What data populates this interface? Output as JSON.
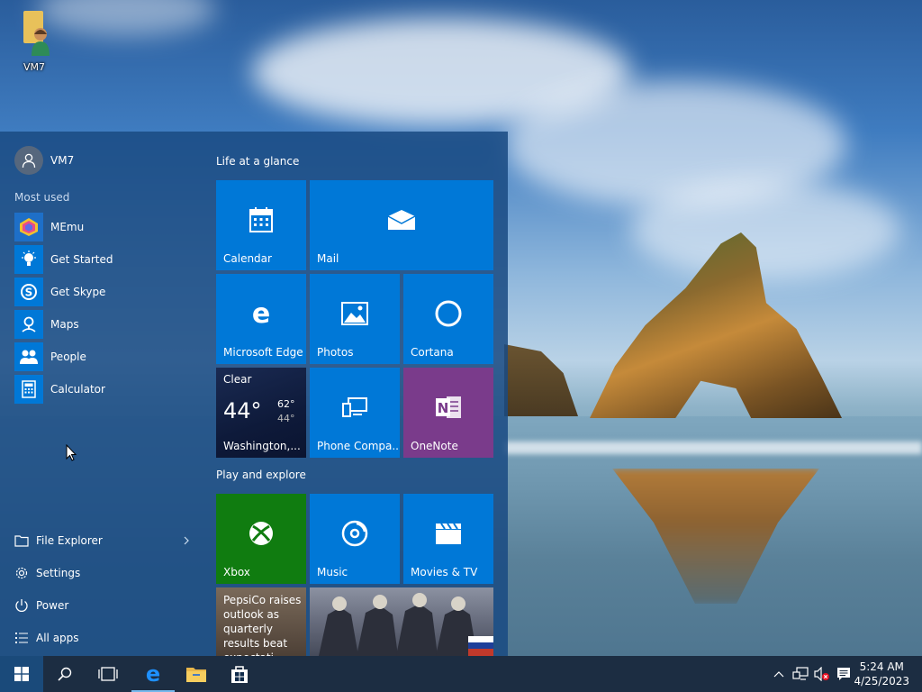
{
  "desktop": {
    "icon_label": "VM7"
  },
  "start_menu": {
    "user_name": "VM7",
    "most_used_label": "Most used",
    "most_used": [
      {
        "label": "MEmu",
        "icon": "memu-icon"
      },
      {
        "label": "Get Started",
        "icon": "lightbulb-icon"
      },
      {
        "label": "Get Skype",
        "icon": "skype-icon"
      },
      {
        "label": "Maps",
        "icon": "maps-icon"
      },
      {
        "label": "People",
        "icon": "people-icon"
      },
      {
        "label": "Calculator",
        "icon": "calculator-icon"
      }
    ],
    "system": [
      {
        "label": "File Explorer",
        "icon": "folder-icon"
      },
      {
        "label": "Settings",
        "icon": "gear-icon"
      },
      {
        "label": "Power",
        "icon": "power-icon"
      },
      {
        "label": "All apps",
        "icon": "list-icon"
      }
    ],
    "groups": {
      "life": "Life at a glance",
      "play": "Play and explore"
    },
    "tiles": {
      "calendar": "Calendar",
      "mail": "Mail",
      "edge": "Microsoft Edge",
      "photos": "Photos",
      "cortana": "Cortana",
      "phone": "Phone Compa...",
      "onenote": "OneNote",
      "xbox": "Xbox",
      "music": "Music",
      "movies": "Movies & TV"
    },
    "weather": {
      "condition": "Clear",
      "temp": "44°",
      "high": "62°",
      "low": "44°",
      "location": "Washington,..."
    },
    "news": {
      "headline": "PepsiCo raises outlook as quarterly results beat expectati..."
    }
  },
  "taskbar": {
    "time": "5:24 AM",
    "date": "4/25/2023"
  },
  "colors": {
    "tile_blue": "#0078d7",
    "xbox_green": "#107c10",
    "onenote_purple": "#7a3b8b",
    "weather_dark": "#0e1a3a"
  }
}
